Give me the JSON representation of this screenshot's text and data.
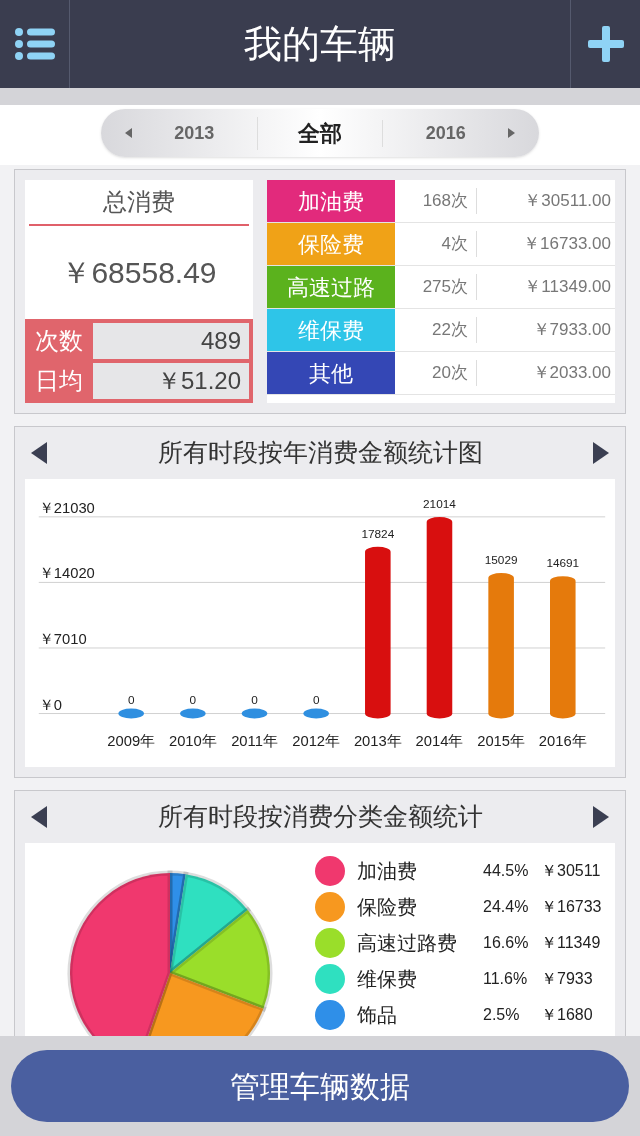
{
  "header": {
    "title": "我的车辆"
  },
  "period_tabs": [
    {
      "label": "2013",
      "selected": false
    },
    {
      "label": "全部",
      "selected": true
    },
    {
      "label": "2016",
      "selected": false
    }
  ],
  "summary": {
    "title": "总消费",
    "total": "￥68558.49",
    "stats": [
      {
        "label": "次数",
        "value": "489"
      },
      {
        "label": "日均",
        "value": "￥51.20"
      }
    ]
  },
  "categories": [
    {
      "name": "加油费",
      "color": "#e22a7c",
      "count": "168次",
      "amount": "￥30511.00"
    },
    {
      "name": "保险费",
      "color": "#f0a217",
      "count": "4次",
      "amount": "￥16733.00"
    },
    {
      "name": "高速过路",
      "color": "#5bb21d",
      "count": "275次",
      "amount": "￥11349.00"
    },
    {
      "name": "维保费",
      "color": "#2ec5e8",
      "count": "22次",
      "amount": "￥7933.00"
    },
    {
      "name": "其他",
      "color": "#3447b5",
      "count": "20次",
      "amount": "￥2033.00"
    }
  ],
  "year_chart": {
    "title": "所有时段按年消费金额统计图",
    "chart_data": {
      "type": "bar",
      "categories": [
        "2009年",
        "2010年",
        "2011年",
        "2012年",
        "2013年",
        "2014年",
        "2015年",
        "2016年"
      ],
      "series": [
        {
          "colors": [
            "#2f8fe0",
            "#2f8fe0",
            "#2f8fe0",
            "#2f8fe0",
            "#d80f0f",
            "#d80f0f",
            "#e57a0c",
            "#e57a0c"
          ],
          "values": [
            0,
            0,
            0,
            0,
            17824,
            21014,
            15029,
            14691
          ]
        }
      ],
      "ylim": [
        0,
        21030
      ],
      "yticks": [
        {
          "value": 0,
          "label": "￥0"
        },
        {
          "value": 7010,
          "label": "￥7010"
        },
        {
          "value": 14020,
          "label": "￥14020"
        },
        {
          "value": 21030,
          "label": "￥21030"
        }
      ],
      "data_labels": true
    }
  },
  "category_chart": {
    "title": "所有时段按消费分类金额统计",
    "legend": [
      {
        "name": "加油费",
        "color": "#f0386e",
        "percent": "44.5%",
        "amount": "￥30511"
      },
      {
        "name": "保险费",
        "color": "#f7981f",
        "percent": "24.4%",
        "amount": "￥16733"
      },
      {
        "name": "高速过路费",
        "color": "#9ade2a",
        "percent": "16.6%",
        "amount": "￥11349"
      },
      {
        "name": "维保费",
        "color": "#2fe0c0",
        "percent": "11.6%",
        "amount": "￥7933"
      },
      {
        "name": "饰品",
        "color": "#2f8fe8",
        "percent": "2.5%",
        "amount": "￥1680"
      }
    ]
  },
  "manage_button": {
    "label": "管理车辆数据"
  }
}
